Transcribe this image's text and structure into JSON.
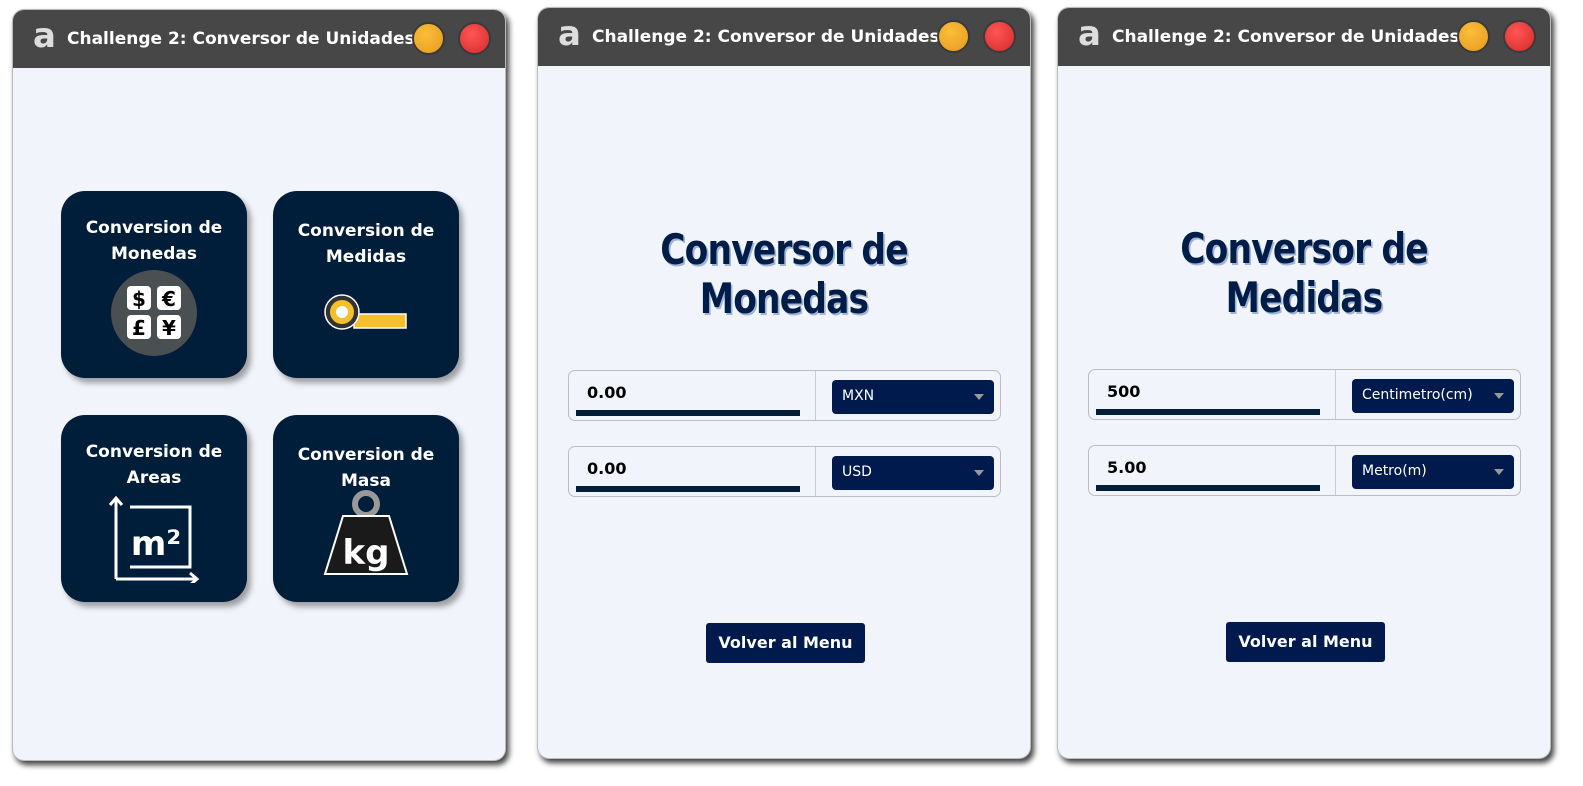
{
  "window_title": "Challenge 2: Conversor de Unidades",
  "logo": "a",
  "menu": {
    "cards": [
      {
        "label": "Conversion de Monedas",
        "icon": "currency-icon"
      },
      {
        "label": "Conversion de Medidas",
        "icon": "tape-measure-icon"
      },
      {
        "label": "Conversion de Areas",
        "icon": "square-meter-icon"
      },
      {
        "label": "Conversion de Masa",
        "icon": "kg-weight-icon"
      }
    ]
  },
  "monedas": {
    "title": "Conversor de Monedas",
    "input1": "0.00",
    "select1": "MXN",
    "input2": "0.00",
    "select2": "USD",
    "back": "Volver al Menu"
  },
  "medidas": {
    "title": "Conversor de Medidas",
    "input1": "500",
    "select1": "Centimetro(cm)",
    "input2": "5.00",
    "select2": "Metro(m)",
    "back": "Volver al Menu"
  },
  "colors": {
    "card": "#001d3a",
    "select": "#001a4d",
    "minimize": "#f0a52a",
    "close": "#e03535"
  }
}
